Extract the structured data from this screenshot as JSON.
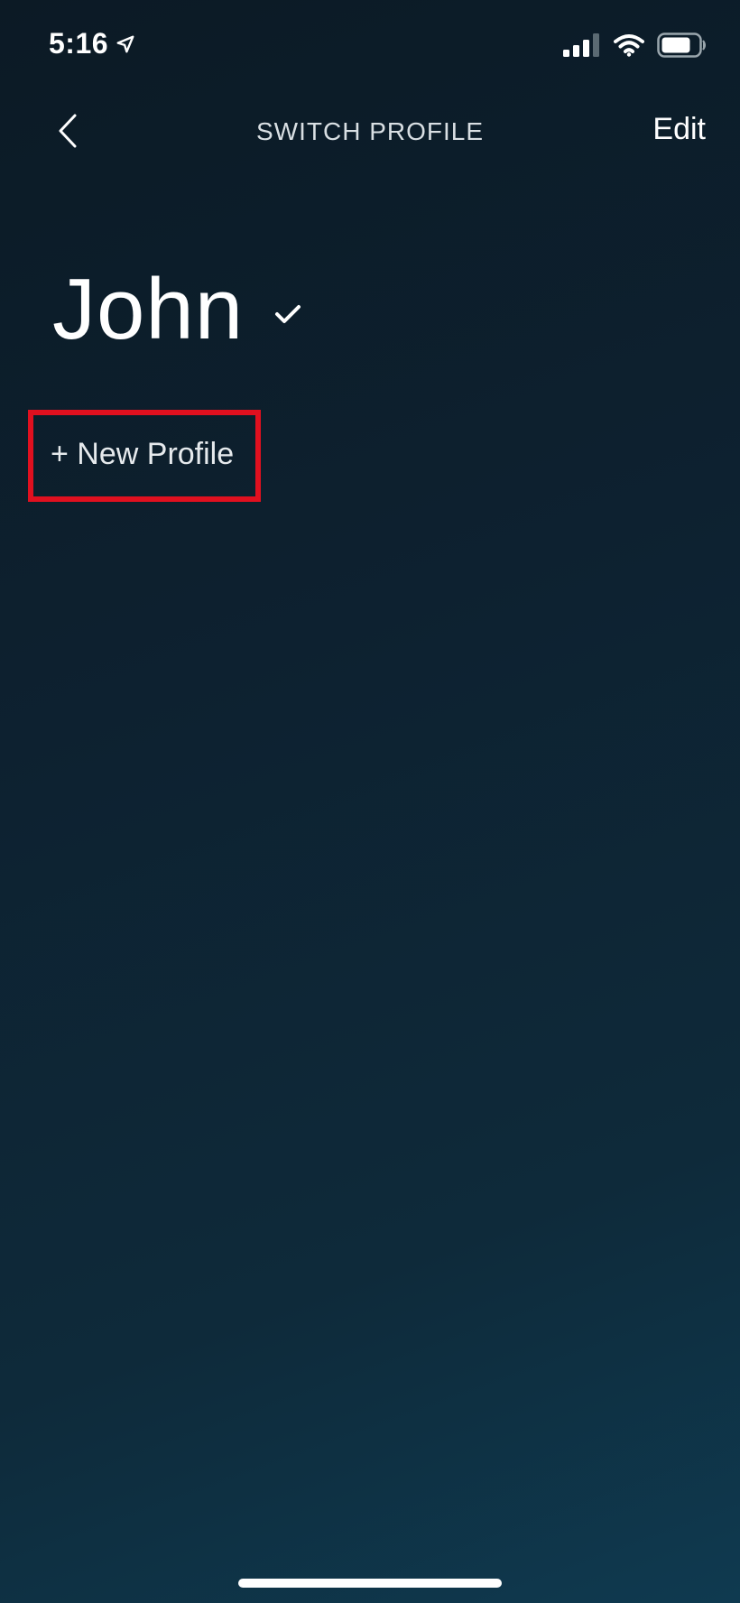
{
  "status_bar": {
    "time": "5:16",
    "location_icon": "location-arrow-icon",
    "signal_icon": "cellular-signal-icon",
    "wifi_icon": "wifi-icon",
    "battery_icon": "battery-icon"
  },
  "nav": {
    "back_icon": "chevron-left-icon",
    "title": "SWITCH PROFILE",
    "edit_label": "Edit"
  },
  "profiles": [
    {
      "name": "John",
      "selected": true,
      "selected_icon": "checkmark-icon"
    }
  ],
  "new_profile_label": "+ New Profile",
  "colors": {
    "highlight_box": "#e0101f",
    "background_top": "#0c1a25",
    "background_bottom": "#0f3a50",
    "text": "#ffffff"
  }
}
